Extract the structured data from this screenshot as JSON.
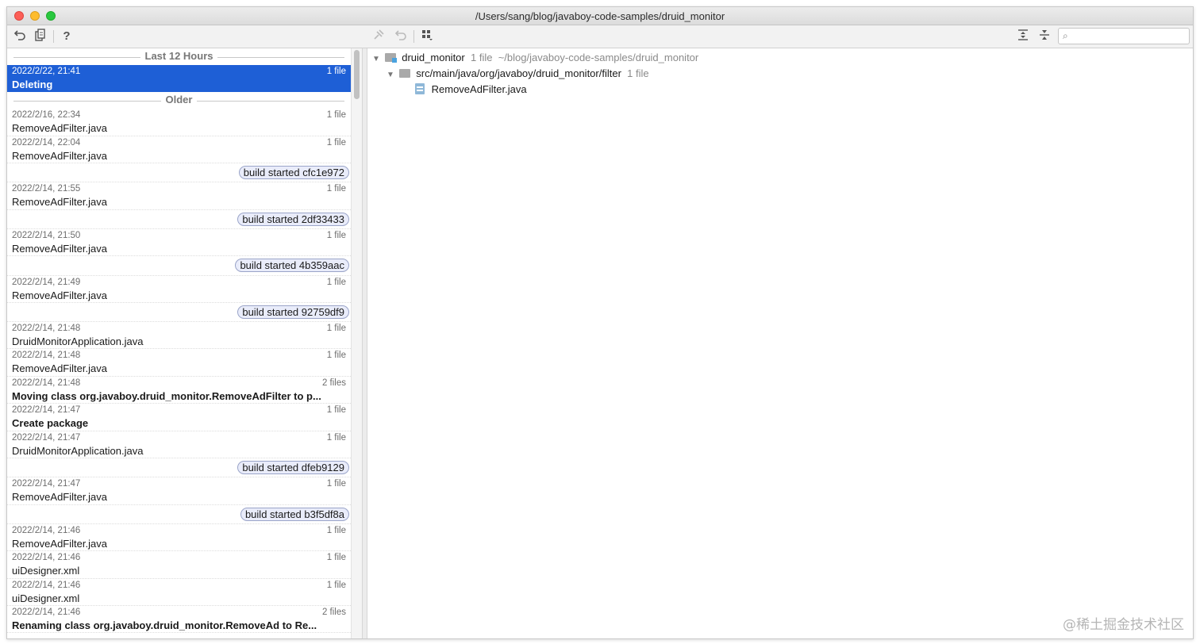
{
  "window": {
    "title": "/Users/sang/blog/javaboy-code-samples/druid_monitor"
  },
  "toolbar": {
    "left_icons": [
      "revert-icon",
      "patch-icon",
      "help-icon"
    ],
    "center_icons": [
      "pin-icon",
      "undo-icon",
      "group-by-icon"
    ],
    "right_icons": [
      "expand-all-icon",
      "collapse-all-icon"
    ],
    "help_glyph": "?",
    "search_value": "",
    "search_placeholder": ""
  },
  "history": {
    "section_recent": "Last 12 Hours",
    "section_older": "Older",
    "selected": {
      "date": "2022/2/22, 21:41",
      "files": "1 file",
      "name": "Deleting"
    },
    "items": [
      {
        "kind": "entry",
        "date": "2022/2/16, 22:34",
        "files": "1 file",
        "name": "RemoveAdFilter.java",
        "bold": false
      },
      {
        "kind": "entry",
        "date": "2022/2/14, 22:04",
        "files": "1 file",
        "name": "RemoveAdFilter.java",
        "bold": false
      },
      {
        "kind": "label",
        "text": "build started cfc1e972"
      },
      {
        "kind": "entry",
        "date": "2022/2/14, 21:55",
        "files": "1 file",
        "name": "RemoveAdFilter.java",
        "bold": false
      },
      {
        "kind": "label",
        "text": "build started 2df33433"
      },
      {
        "kind": "entry",
        "date": "2022/2/14, 21:50",
        "files": "1 file",
        "name": "RemoveAdFilter.java",
        "bold": false
      },
      {
        "kind": "label",
        "text": "build started 4b359aac"
      },
      {
        "kind": "entry",
        "date": "2022/2/14, 21:49",
        "files": "1 file",
        "name": "RemoveAdFilter.java",
        "bold": false
      },
      {
        "kind": "label",
        "text": "build started 92759df9"
      },
      {
        "kind": "entry",
        "date": "2022/2/14, 21:48",
        "files": "1 file",
        "name": "DruidMonitorApplication.java",
        "bold": false
      },
      {
        "kind": "entry",
        "date": "2022/2/14, 21:48",
        "files": "1 file",
        "name": "RemoveAdFilter.java",
        "bold": false
      },
      {
        "kind": "entry",
        "date": "2022/2/14, 21:48",
        "files": "2 files",
        "name": "Moving class org.javaboy.druid_monitor.RemoveAdFilter to p...",
        "bold": true
      },
      {
        "kind": "entry",
        "date": "2022/2/14, 21:47",
        "files": "1 file",
        "name": "Create package",
        "bold": true
      },
      {
        "kind": "entry",
        "date": "2022/2/14, 21:47",
        "files": "1 file",
        "name": "DruidMonitorApplication.java",
        "bold": false
      },
      {
        "kind": "label",
        "text": "build started dfeb9129"
      },
      {
        "kind": "entry",
        "date": "2022/2/14, 21:47",
        "files": "1 file",
        "name": "RemoveAdFilter.java",
        "bold": false
      },
      {
        "kind": "label",
        "text": "build started b3f5df8a"
      },
      {
        "kind": "entry",
        "date": "2022/2/14, 21:46",
        "files": "1 file",
        "name": "RemoveAdFilter.java",
        "bold": false
      },
      {
        "kind": "entry",
        "date": "2022/2/14, 21:46",
        "files": "1 file",
        "name": "uiDesigner.xml",
        "bold": false
      },
      {
        "kind": "entry",
        "date": "2022/2/14, 21:46",
        "files": "1 file",
        "name": "uiDesigner.xml",
        "bold": false
      },
      {
        "kind": "entry",
        "date": "2022/2/14, 21:46",
        "files": "2 files",
        "name": "Renaming class org.javaboy.druid_monitor.RemoveAd to Re...",
        "bold": true
      }
    ]
  },
  "tree": {
    "root": {
      "name": "druid_monitor",
      "count": "1 file",
      "path": "~/blog/javaboy-code-samples/druid_monitor"
    },
    "folder": {
      "name": "src/main/java/org/javaboy/druid_monitor/filter",
      "count": "1 file"
    },
    "file": {
      "name": "RemoveAdFilter.java"
    }
  },
  "watermark": "@稀土掘金技术社区"
}
